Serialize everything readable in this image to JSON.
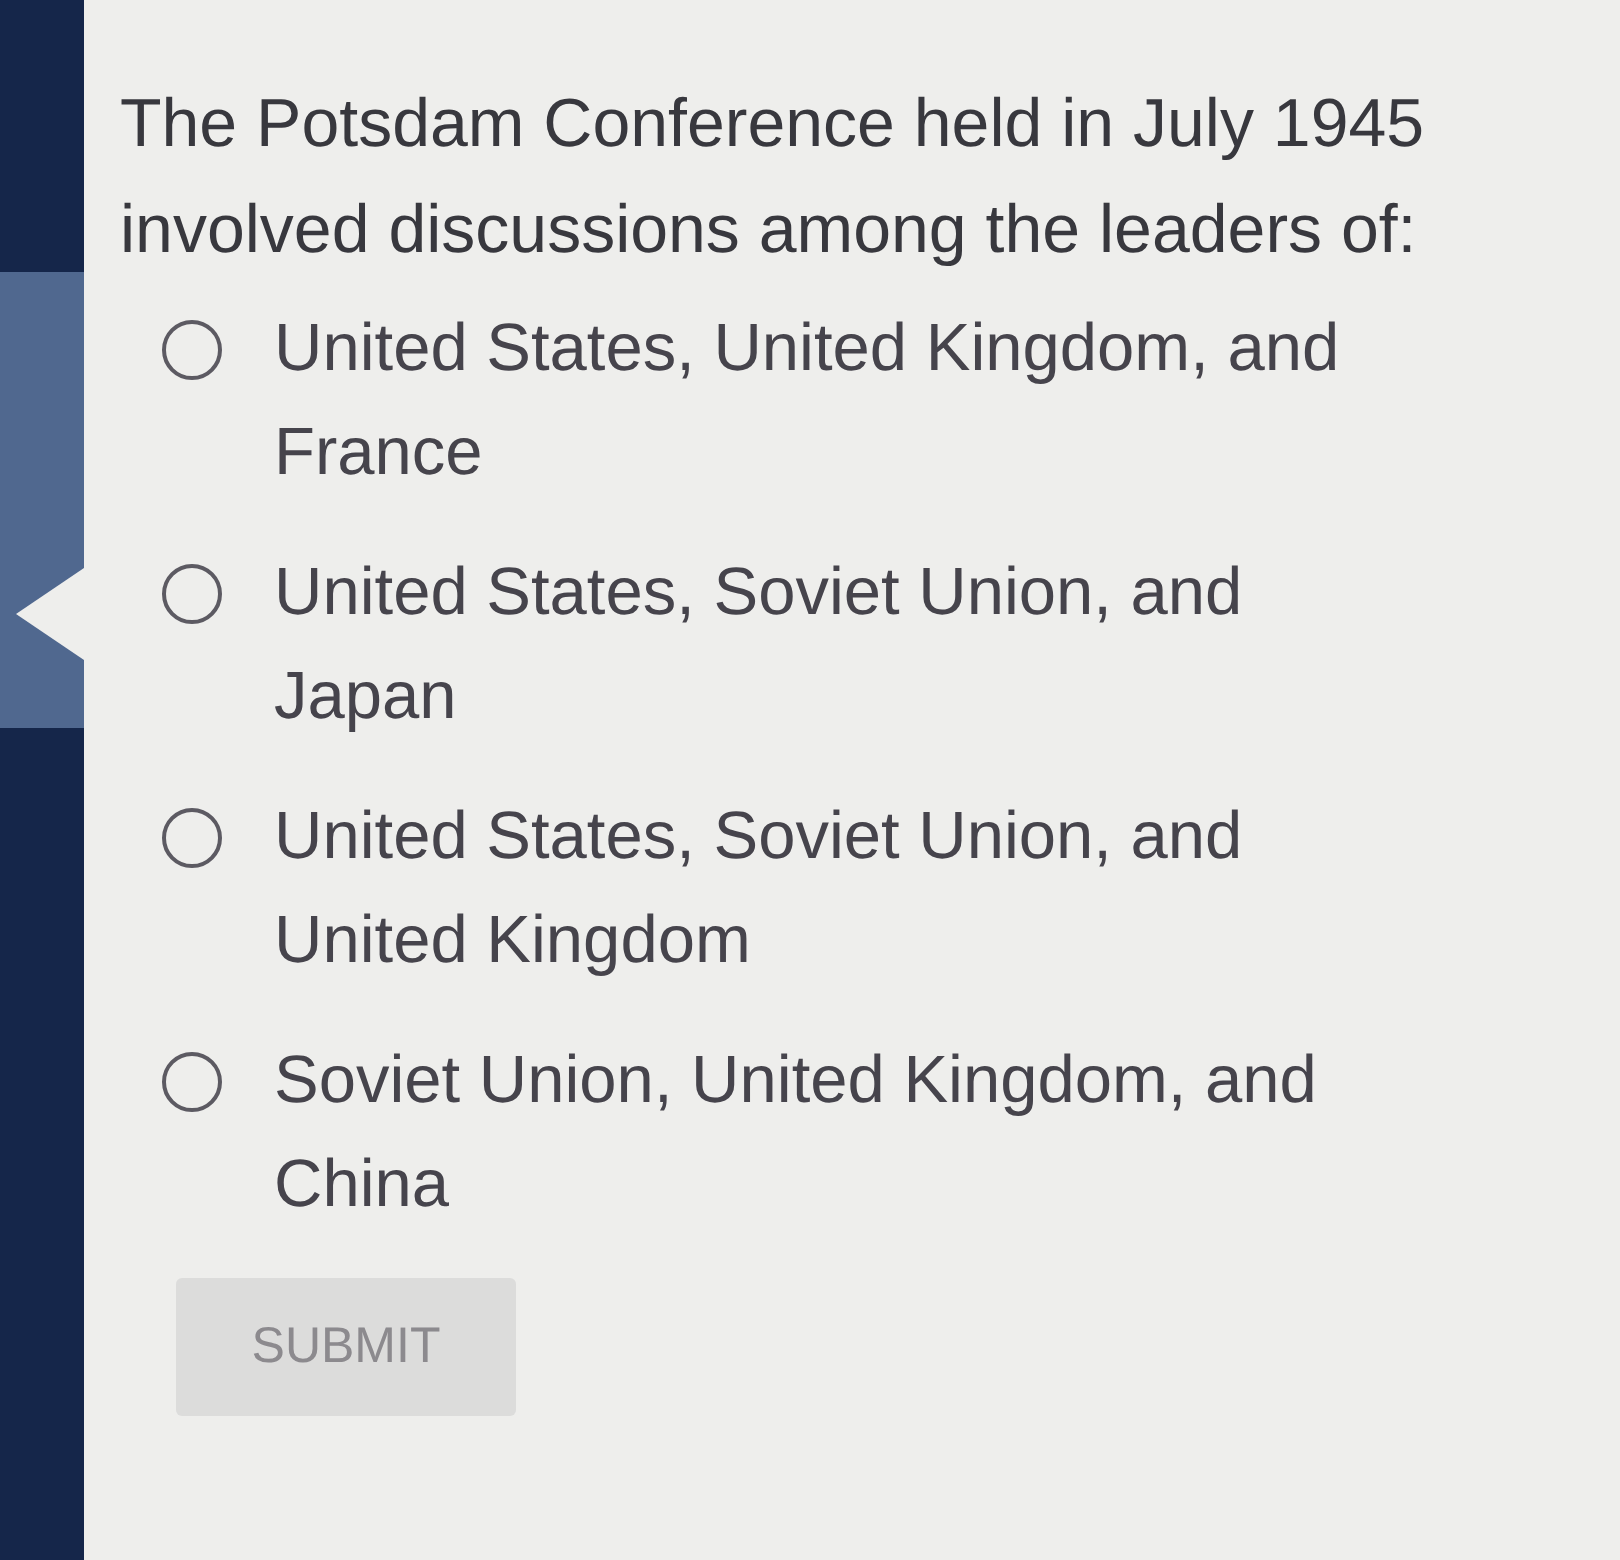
{
  "question": {
    "text": "The Potsdam Conference held in July 1945 involved discussions among the leaders of:"
  },
  "options": [
    {
      "label": "United States, United Kingdom, and France",
      "selected": false
    },
    {
      "label": "United States, Soviet Union, and Japan",
      "selected": false
    },
    {
      "label": "United States, Soviet Union, and United Kingdom",
      "selected": false
    },
    {
      "label": "Soviet Union, United Kingdom, and China",
      "selected": false
    }
  ],
  "submit_button": {
    "label": "SUBMIT",
    "disabled": true
  }
}
